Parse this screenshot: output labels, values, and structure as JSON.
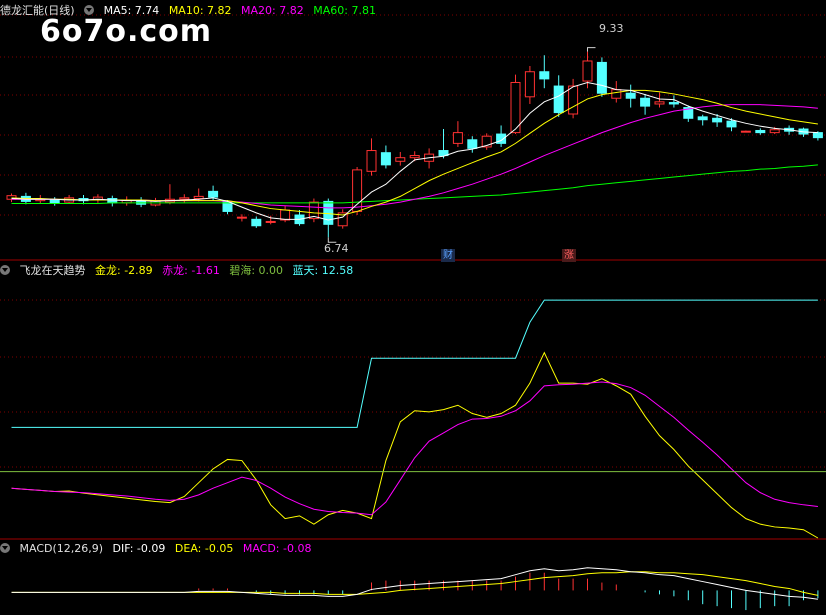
{
  "title": "德龙汇能(日线)",
  "watermark": "6o7o.com",
  "colors": {
    "up": "#ff3232",
    "down": "#54ffff",
    "ma5": "#ffffff",
    "ma10": "#ffff00",
    "ma20": "#ff00ff",
    "ma60": "#00ff00",
    "grid": "#7f0000",
    "zero": "#7fbf3f"
  },
  "main_header": {
    "ma5": "MA5: 7.74",
    "ma10": "MA10: 7.82",
    "ma20": "MA20: 7.82",
    "ma60": "MA60: 7.81"
  },
  "indicator_header": {
    "name": "飞龙在天趋势",
    "jinlong": "金龙: -2.89",
    "chilong": "赤龙: -1.61",
    "bihai": "碧海: 0.00",
    "lantian": "蓝天: 12.58"
  },
  "macd_header": {
    "name": "MACD(12,26,9)",
    "dif": "DIF: -0.09",
    "dea": "DEA: -0.05",
    "macd": "MACD: -0.08"
  },
  "annotations": {
    "high": "9.33",
    "low": "6.74",
    "tag1": "财",
    "tag2": "涨"
  },
  "chart_data": [
    {
      "type": "candlestick",
      "ylim": [
        6.45,
        9.8
      ],
      "candles": [
        [
          7.27,
          7.32,
          7.23,
          7.35
        ],
        [
          7.31,
          7.24,
          7.2,
          7.36
        ],
        [
          7.25,
          7.27,
          7.21,
          7.33
        ],
        [
          7.26,
          7.22,
          7.18,
          7.3
        ],
        [
          7.23,
          7.29,
          7.21,
          7.33
        ],
        [
          7.28,
          7.25,
          7.2,
          7.33
        ],
        [
          7.26,
          7.3,
          7.22,
          7.34
        ],
        [
          7.28,
          7.22,
          7.17,
          7.32
        ],
        [
          7.22,
          7.26,
          7.18,
          7.31
        ],
        [
          7.25,
          7.2,
          7.16,
          7.3
        ],
        [
          7.19,
          7.25,
          7.17,
          7.29
        ],
        [
          7.23,
          7.27,
          7.2,
          7.48
        ],
        [
          7.27,
          7.29,
          7.22,
          7.34
        ],
        [
          7.28,
          7.31,
          7.24,
          7.42
        ],
        [
          7.38,
          7.3,
          7.25,
          7.46
        ],
        [
          7.24,
          7.1,
          7.06,
          7.26
        ],
        [
          7.02,
          7.02,
          6.96,
          7.06
        ],
        [
          6.99,
          6.9,
          6.87,
          7.03
        ],
        [
          6.95,
          6.96,
          6.92,
          7.04
        ],
        [
          6.98,
          7.12,
          6.95,
          7.18
        ],
        [
          7.05,
          6.93,
          6.9,
          7.12
        ],
        [
          7.0,
          7.23,
          6.95,
          7.28
        ],
        [
          7.24,
          6.92,
          6.74,
          7.28
        ],
        [
          6.9,
          7.08,
          6.86,
          7.13
        ],
        [
          7.1,
          7.68,
          7.05,
          7.72
        ],
        [
          7.66,
          7.95,
          7.6,
          8.12
        ],
        [
          7.92,
          7.75,
          7.7,
          8.02
        ],
        [
          7.8,
          7.85,
          7.74,
          7.93
        ],
        [
          7.85,
          7.88,
          7.8,
          7.94
        ],
        [
          7.8,
          7.9,
          7.7,
          7.98
        ],
        [
          7.95,
          7.88,
          7.84,
          8.25
        ],
        [
          8.05,
          8.2,
          8.0,
          8.36
        ],
        [
          8.1,
          7.98,
          7.92,
          8.15
        ],
        [
          8.0,
          8.15,
          7.96,
          8.19
        ],
        [
          8.18,
          8.05,
          8.0,
          8.3
        ],
        [
          8.2,
          8.9,
          8.18,
          9.01
        ],
        [
          8.7,
          9.05,
          8.6,
          9.13
        ],
        [
          9.05,
          8.95,
          8.82,
          9.28
        ],
        [
          8.85,
          8.48,
          8.42,
          9.0
        ],
        [
          8.46,
          8.85,
          8.4,
          8.95
        ],
        [
          8.92,
          9.2,
          8.82,
          9.33
        ],
        [
          9.18,
          8.75,
          8.7,
          9.25
        ],
        [
          8.68,
          8.8,
          8.62,
          8.92
        ],
        [
          8.75,
          8.68,
          8.55,
          8.87
        ],
        [
          8.68,
          8.57,
          8.45,
          8.74
        ],
        [
          8.6,
          8.63,
          8.55,
          8.76
        ],
        [
          8.62,
          8.6,
          8.55,
          8.72
        ],
        [
          8.55,
          8.4,
          8.35,
          8.58
        ],
        [
          8.42,
          8.38,
          8.3,
          8.45
        ],
        [
          8.4,
          8.35,
          8.28,
          8.46
        ],
        [
          8.36,
          8.28,
          8.22,
          8.4
        ],
        [
          8.22,
          8.22,
          8.21,
          8.23
        ],
        [
          8.23,
          8.2,
          8.17,
          8.26
        ],
        [
          8.2,
          8.24,
          8.18,
          8.28
        ],
        [
          8.26,
          8.22,
          8.17,
          8.3
        ],
        [
          8.25,
          8.18,
          8.14,
          8.27
        ],
        [
          8.2,
          8.13,
          8.09,
          8.22
        ]
      ],
      "ma5": [
        7.28,
        7.27,
        7.27,
        7.27,
        7.26,
        7.26,
        7.27,
        7.26,
        7.25,
        7.25,
        7.24,
        7.25,
        7.26,
        7.27,
        7.29,
        7.24,
        7.16,
        7.08,
        7.01,
        6.99,
        6.99,
        7.03,
        6.98,
        7.02,
        7.2,
        7.37,
        7.48,
        7.66,
        7.82,
        7.85,
        7.87,
        7.94,
        7.97,
        8.02,
        8.09,
        8.25,
        8.47,
        8.63,
        8.71,
        8.84,
        8.9,
        8.86,
        8.8,
        8.79,
        8.73,
        8.67,
        8.66,
        8.57,
        8.5,
        8.44,
        8.38,
        8.33,
        8.29,
        8.26,
        8.24,
        8.21,
        8.2
      ],
      "ma10": [
        7.29,
        7.28,
        7.28,
        7.27,
        7.27,
        7.26,
        7.26,
        7.26,
        7.26,
        7.26,
        7.25,
        7.25,
        7.25,
        7.25,
        7.25,
        7.25,
        7.22,
        7.18,
        7.14,
        7.12,
        7.1,
        7.08,
        7.07,
        7.05,
        7.1,
        7.17,
        7.23,
        7.31,
        7.42,
        7.53,
        7.62,
        7.7,
        7.78,
        7.86,
        7.93,
        8.05,
        8.19,
        8.33,
        8.45,
        8.56,
        8.67,
        8.73,
        8.76,
        8.79,
        8.79,
        8.77,
        8.74,
        8.7,
        8.66,
        8.61,
        8.55,
        8.5,
        8.46,
        8.42,
        8.38,
        8.35,
        8.32
      ],
      "ma20": [
        7.27,
        7.27,
        7.27,
        7.27,
        7.26,
        7.26,
        7.26,
        7.26,
        7.26,
        7.26,
        7.25,
        7.25,
        7.25,
        7.25,
        7.25,
        7.24,
        7.23,
        7.21,
        7.19,
        7.18,
        7.17,
        7.16,
        7.15,
        7.15,
        7.16,
        7.18,
        7.2,
        7.23,
        7.27,
        7.31,
        7.36,
        7.42,
        7.48,
        7.55,
        7.62,
        7.7,
        7.79,
        7.88,
        7.96,
        8.04,
        8.12,
        8.2,
        8.27,
        8.34,
        8.4,
        8.45,
        8.5,
        8.53,
        8.56,
        8.58,
        8.59,
        8.59,
        8.59,
        8.58,
        8.57,
        8.56,
        8.54
      ],
      "ma60": [
        7.21,
        7.21,
        7.21,
        7.21,
        7.21,
        7.21,
        7.21,
        7.22,
        7.22,
        7.22,
        7.22,
        7.22,
        7.22,
        7.22,
        7.22,
        7.22,
        7.22,
        7.22,
        7.22,
        7.22,
        7.22,
        7.22,
        7.22,
        7.22,
        7.23,
        7.24,
        7.25,
        7.26,
        7.27,
        7.28,
        7.29,
        7.3,
        7.31,
        7.32,
        7.33,
        7.35,
        7.37,
        7.39,
        7.41,
        7.43,
        7.46,
        7.48,
        7.5,
        7.52,
        7.54,
        7.56,
        7.58,
        7.6,
        7.62,
        7.64,
        7.66,
        7.67,
        7.69,
        7.7,
        7.72,
        7.73,
        7.75
      ]
    },
    {
      "type": "line",
      "name": "飞龙在天趋势",
      "ylim": [
        -12,
        35
      ],
      "series": [
        {
          "name": "金龙",
          "values": [
            -3.0,
            -3.2,
            -3.4,
            -3.6,
            -3.5,
            -3.9,
            -4.2,
            -4.5,
            -4.8,
            -5.1,
            -5.4,
            -5.6,
            -4.5,
            -2.0,
            0.5,
            2.2,
            2.0,
            -1.5,
            -6.0,
            -8.5,
            -8.0,
            -9.5,
            -7.8,
            -7.0,
            -7.5,
            -8.5,
            2.0,
            9.0,
            11.0,
            10.8,
            11.2,
            12.0,
            10.5,
            9.8,
            10.5,
            12.0,
            16.0,
            21.5,
            16.0,
            16.0,
            15.8,
            16.8,
            15.5,
            14.0,
            10.0,
            6.5,
            4.0,
            1.0,
            -1.5,
            -4.0,
            -6.5,
            -8.5,
            -9.5,
            -10.0,
            -10.2,
            -10.5,
            -12.0
          ]
        },
        {
          "name": "赤龙",
          "values": [
            -3.0,
            -3.2,
            -3.4,
            -3.6,
            -3.7,
            -3.8,
            -4.0,
            -4.2,
            -4.4,
            -4.7,
            -5.0,
            -5.2,
            -5.0,
            -4.2,
            -3.0,
            -2.0,
            -1.0,
            -1.6,
            -3.0,
            -4.6,
            -5.8,
            -6.8,
            -7.2,
            -7.4,
            -7.5,
            -7.8,
            -5.5,
            -1.5,
            2.5,
            5.5,
            7.0,
            8.5,
            9.5,
            9.6,
            10.0,
            11.0,
            12.8,
            15.5,
            15.7,
            15.8,
            16.0,
            16.2,
            15.9,
            15.2,
            13.8,
            11.8,
            9.8,
            7.5,
            5.3,
            3.0,
            0.5,
            -2.0,
            -3.8,
            -5.0,
            -5.6,
            -6.0,
            -6.3
          ]
        },
        {
          "name": "碧海",
          "values": [
            0.0,
            0.0,
            0.0,
            0.0,
            0.0,
            0.0,
            0.0,
            0.0,
            0.0,
            0.0,
            0.0,
            0.0,
            0.0,
            0.0,
            0.0,
            0.0,
            0.0,
            0.0,
            0.0,
            0.0,
            0.0,
            0.0,
            0.0,
            0.0,
            0.0,
            0.0,
            0.0,
            0.0,
            0.0,
            0.0,
            0.0,
            0.0,
            0.0,
            0.0,
            0.0,
            0.0,
            0.0,
            0.0,
            0.0,
            0.0,
            0.0,
            0.0,
            0.0,
            0.0,
            0.0,
            0.0,
            0.0,
            0.0,
            0.0,
            0.0,
            0.0,
            0.0,
            0.0,
            0.0,
            0.0,
            0.0,
            0.0
          ]
        },
        {
          "name": "蓝天",
          "values": [
            8.0,
            8.0,
            8.0,
            8.0,
            8.0,
            8.0,
            8.0,
            8.0,
            8.0,
            8.0,
            8.0,
            8.0,
            8.0,
            8.0,
            8.0,
            8.0,
            8.0,
            8.0,
            8.0,
            8.0,
            8.0,
            8.0,
            8.0,
            8.0,
            8.0,
            20.5,
            20.5,
            20.5,
            20.5,
            20.5,
            20.5,
            20.5,
            20.5,
            20.5,
            20.5,
            20.5,
            27.0,
            31.0,
            31.0,
            31.0,
            31.0,
            31.0,
            31.0,
            31.0,
            31.0,
            31.0,
            31.0,
            31.0,
            31.0,
            31.0,
            31.0,
            31.0,
            31.0,
            31.0,
            31.0,
            31.0,
            31.0
          ]
        }
      ]
    },
    {
      "type": "bar+line",
      "name": "MACD(12,26,9)",
      "ylim": [
        -0.25,
        0.35
      ],
      "dif": [
        -0.02,
        -0.02,
        -0.02,
        -0.02,
        -0.02,
        -0.02,
        -0.02,
        -0.02,
        -0.02,
        -0.02,
        -0.02,
        -0.02,
        -0.02,
        -0.01,
        -0.01,
        -0.01,
        -0.02,
        -0.03,
        -0.04,
        -0.05,
        -0.05,
        -0.05,
        -0.06,
        -0.06,
        -0.04,
        0.01,
        0.03,
        0.05,
        0.06,
        0.07,
        0.08,
        0.09,
        0.1,
        0.11,
        0.12,
        0.16,
        0.2,
        0.22,
        0.2,
        0.21,
        0.23,
        0.22,
        0.21,
        0.19,
        0.18,
        0.16,
        0.15,
        0.12,
        0.09,
        0.06,
        0.03,
        0.0,
        -0.02,
        -0.04,
        -0.06,
        -0.07,
        -0.09
      ],
      "dea": [
        -0.02,
        -0.02,
        -0.02,
        -0.02,
        -0.02,
        -0.02,
        -0.02,
        -0.02,
        -0.02,
        -0.02,
        -0.02,
        -0.02,
        -0.02,
        -0.02,
        -0.02,
        -0.02,
        -0.02,
        -0.02,
        -0.02,
        -0.03,
        -0.03,
        -0.03,
        -0.04,
        -0.04,
        -0.04,
        -0.03,
        -0.02,
        0.0,
        0.01,
        0.02,
        0.03,
        0.04,
        0.05,
        0.06,
        0.07,
        0.09,
        0.11,
        0.13,
        0.14,
        0.15,
        0.17,
        0.18,
        0.18,
        0.19,
        0.19,
        0.18,
        0.18,
        0.17,
        0.16,
        0.14,
        0.12,
        0.1,
        0.07,
        0.04,
        0.02,
        -0.02,
        -0.05
      ],
      "macd": [
        0.0,
        0.0,
        0.0,
        0.0,
        0.0,
        0.0,
        0.0,
        0.0,
        0.0,
        0.0,
        0.0,
        0.0,
        0.0,
        0.02,
        0.02,
        0.02,
        0.0,
        -0.02,
        -0.04,
        -0.04,
        -0.04,
        -0.04,
        -0.04,
        -0.04,
        0.0,
        0.08,
        0.1,
        0.1,
        0.1,
        0.1,
        0.1,
        0.1,
        0.1,
        0.1,
        0.1,
        0.14,
        0.18,
        0.18,
        0.12,
        0.12,
        0.12,
        0.08,
        0.06,
        0.0,
        -0.02,
        -0.04,
        -0.06,
        -0.1,
        -0.14,
        -0.16,
        -0.18,
        -0.2,
        -0.18,
        -0.16,
        -0.16,
        -0.1,
        -0.08
      ]
    }
  ]
}
